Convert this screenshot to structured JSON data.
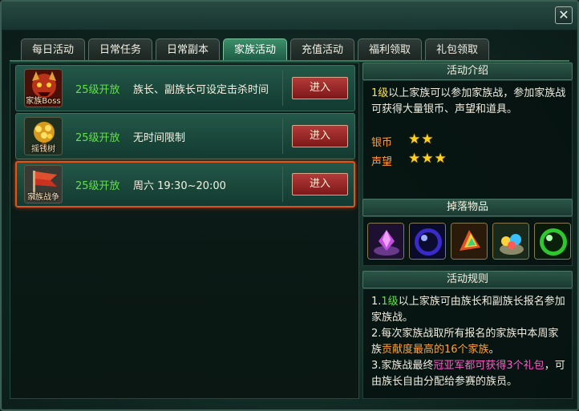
{
  "window": {
    "close_label": "✕"
  },
  "tabs": [
    {
      "label": "每日活动"
    },
    {
      "label": "日常任务"
    },
    {
      "label": "日常副本"
    },
    {
      "label": "家族活动"
    },
    {
      "label": "充值活动"
    },
    {
      "label": "福利领取"
    },
    {
      "label": "礼包领取"
    }
  ],
  "active_tab": "家族活动",
  "activities": [
    {
      "icon_name": "family-boss-icon",
      "icon_label": "家族Boss",
      "level": "25级开放",
      "desc": "族长、副族长可设定击杀时间",
      "button": "进入"
    },
    {
      "icon_name": "money-tree-icon",
      "icon_label": "摇钱树",
      "level": "25级开放",
      "desc": "无时间限制",
      "button": "进入"
    },
    {
      "icon_name": "family-war-flag-icon",
      "icon_label": "家族战争",
      "level": "25级开放",
      "desc": "周六 19:30~20:00",
      "button": "进入",
      "selected": true
    }
  ],
  "intro": {
    "title": "活动介绍",
    "text_prefix_hl": "1级",
    "text_rest": "以上家族可以参加家族战，参加家族战可获得大量银币、声望和道具。",
    "ratings": [
      {
        "label": "银币",
        "stars": "★★"
      },
      {
        "label": "声望",
        "stars": "★★★"
      }
    ]
  },
  "drops": {
    "title": "掉落物品",
    "items": [
      "purple-gem-icon",
      "blue-orb-icon",
      "rainbow-crystal-icon",
      "gem-bowl-icon",
      "green-orb-icon"
    ]
  },
  "rules": {
    "title": "活动规则",
    "r1_a": "1.",
    "r1_hl": "1级",
    "r1_b": "以上家族可由族长和副族长报名参加家族战。",
    "r2_a": "2.每次家族战取所有报名的家族中本周家族",
    "r2_hl": "贡献度最高的16个家族",
    "r2_b": "。",
    "r3_a": "3.家族战最终",
    "r3_hl": "冠亚军都可获得3个礼包",
    "r3_b": "，可由族长自由分配给参赛的族员。"
  },
  "colors": {
    "accent_green": "#62e04a",
    "selected_border": "#e0541c",
    "button_red": "#b43a3a"
  }
}
